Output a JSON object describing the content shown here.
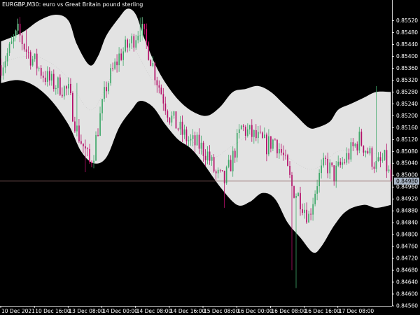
{
  "header": {
    "symbol_title": "EURGBP,M30",
    "description": "euro vs Great Britain pound sterling"
  },
  "colors": {
    "background": "#000000",
    "band_fill": "#e3e3e3",
    "bull_candle": "#7ee0a4",
    "bear_candle": "#e0197d",
    "bull_candle_on_band": "#3fa86a",
    "bear_candle_on_band": "#b5106a",
    "axis_text": "#ffffff",
    "bid_line": "#8a6060",
    "bid_tag_bg": "#a8b4c4"
  },
  "current_price": "0.84980",
  "chart_data": {
    "type": "candlestick",
    "title": "",
    "y_range": [
      0.8456,
      0.8558
    ],
    "y_ticks": [
      "0.85520",
      "0.85480",
      "0.85440",
      "0.85400",
      "0.85360",
      "0.85320",
      "0.85280",
      "0.85240",
      "0.85200",
      "0.85160",
      "0.85120",
      "0.85080",
      "0.85040",
      "0.85000",
      "0.84960",
      "0.84920",
      "0.84880",
      "0.84840",
      "0.84800",
      "0.84760",
      "0.84720",
      "0.84680",
      "0.84640",
      "0.84600",
      "0.84560"
    ],
    "y_tick_values": [
      0.8552,
      0.8548,
      0.8544,
      0.854,
      0.8536,
      0.8532,
      0.8528,
      0.8524,
      0.852,
      0.8516,
      0.8512,
      0.8508,
      0.8504,
      0.85,
      0.8496,
      0.8492,
      0.8488,
      0.8484,
      0.848,
      0.8476,
      0.8472,
      0.8468,
      0.8464,
      0.846,
      0.8456
    ],
    "x_ticks": [
      "10 Dec 2021",
      "10 Dec 16:00",
      "13 Dec 08:00",
      "14 Dec 00:00",
      "14 Dec 08:00",
      "14 Dec 16:00",
      "15 Dec 08:00",
      "16 Dec 00:00",
      "16 Dec 08:00",
      "16 Dec 16:00",
      "17 Dec 08:00"
    ],
    "x_tick_bar_index": [
      0,
      16,
      32,
      48,
      64,
      80,
      96,
      112,
      128,
      144,
      160
    ],
    "bar_count": 186,
    "bollinger": {
      "upper": [
        [
          0,
          0.8545
        ],
        [
          10,
          0.8548
        ],
        [
          18,
          0.8552
        ],
        [
          26,
          0.8554
        ],
        [
          32,
          0.8552
        ],
        [
          36,
          0.8544
        ],
        [
          42,
          0.8537
        ],
        [
          46,
          0.854
        ],
        [
          50,
          0.8547
        ],
        [
          56,
          0.8553
        ],
        [
          60,
          0.8556
        ],
        [
          64,
          0.8554
        ],
        [
          68,
          0.8546
        ],
        [
          74,
          0.8536
        ],
        [
          80,
          0.8529
        ],
        [
          86,
          0.8524
        ],
        [
          92,
          0.8521
        ],
        [
          98,
          0.852
        ],
        [
          104,
          0.8523
        ],
        [
          110,
          0.8528
        ],
        [
          116,
          0.8529
        ],
        [
          122,
          0.853
        ],
        [
          128,
          0.8528
        ],
        [
          134,
          0.8524
        ],
        [
          140,
          0.852
        ],
        [
          146,
          0.8516
        ],
        [
          150,
          0.8516
        ],
        [
          156,
          0.8518
        ],
        [
          160,
          0.8522
        ],
        [
          166,
          0.8524
        ],
        [
          172,
          0.8526
        ],
        [
          178,
          0.8528
        ],
        [
          185,
          0.8528
        ]
      ],
      "middle": [
        [
          0,
          0.8538
        ],
        [
          16,
          0.854
        ],
        [
          30,
          0.8534
        ],
        [
          42,
          0.8522
        ],
        [
          50,
          0.853
        ],
        [
          60,
          0.8544
        ],
        [
          70,
          0.8534
        ],
        [
          80,
          0.8522
        ],
        [
          90,
          0.8512
        ],
        [
          100,
          0.8506
        ],
        [
          110,
          0.851
        ],
        [
          122,
          0.8514
        ],
        [
          136,
          0.8506
        ],
        [
          148,
          0.8502
        ],
        [
          160,
          0.8508
        ],
        [
          172,
          0.8508
        ],
        [
          185,
          0.8506
        ]
      ],
      "lower": [
        [
          0,
          0.8531
        ],
        [
          8,
          0.8532
        ],
        [
          16,
          0.853
        ],
        [
          24,
          0.8525
        ],
        [
          32,
          0.8517
        ],
        [
          38,
          0.8508
        ],
        [
          44,
          0.8504
        ],
        [
          50,
          0.8506
        ],
        [
          56,
          0.8516
        ],
        [
          62,
          0.8522
        ],
        [
          66,
          0.8525
        ],
        [
          72,
          0.8523
        ],
        [
          78,
          0.8517
        ],
        [
          84,
          0.8512
        ],
        [
          90,
          0.8509
        ],
        [
          96,
          0.8504
        ],
        [
          104,
          0.8496
        ],
        [
          112,
          0.849
        ],
        [
          118,
          0.8491
        ],
        [
          124,
          0.8494
        ],
        [
          130,
          0.8492
        ],
        [
          136,
          0.8484
        ],
        [
          142,
          0.8479
        ],
        [
          148,
          0.8474
        ],
        [
          152,
          0.8476
        ],
        [
          158,
          0.8483
        ],
        [
          164,
          0.8488
        ],
        [
          172,
          0.849
        ],
        [
          178,
          0.8489
        ],
        [
          185,
          0.849
        ]
      ]
    },
    "candles": {
      "anchors": [
        [
          0,
          0.8537
        ],
        [
          4,
          0.8542
        ],
        [
          8,
          0.8548
        ],
        [
          12,
          0.8542
        ],
        [
          16,
          0.8538
        ],
        [
          20,
          0.8534
        ],
        [
          24,
          0.8531
        ],
        [
          28,
          0.853
        ],
        [
          32,
          0.8528
        ],
        [
          36,
          0.8515
        ],
        [
          40,
          0.8508
        ],
        [
          42,
          0.8504
        ],
        [
          44,
          0.8508
        ],
        [
          46,
          0.8516
        ],
        [
          50,
          0.853
        ],
        [
          56,
          0.854
        ],
        [
          62,
          0.8545
        ],
        [
          66,
          0.855
        ],
        [
          70,
          0.8542
        ],
        [
          74,
          0.8532
        ],
        [
          80,
          0.852
        ],
        [
          86,
          0.8514
        ],
        [
          90,
          0.8511
        ],
        [
          94,
          0.851
        ],
        [
          98,
          0.8507
        ],
        [
          102,
          0.85
        ],
        [
          106,
          0.8498
        ],
        [
          110,
          0.8506
        ],
        [
          114,
          0.8516
        ],
        [
          118,
          0.8514
        ],
        [
          122,
          0.8512
        ],
        [
          126,
          0.851
        ],
        [
          130,
          0.8512
        ],
        [
          134,
          0.8506
        ],
        [
          138,
          0.8496
        ],
        [
          142,
          0.8492
        ],
        [
          146,
          0.8486
        ],
        [
          150,
          0.8498
        ],
        [
          154,
          0.8504
        ],
        [
          158,
          0.85
        ],
        [
          162,
          0.8504
        ],
        [
          166,
          0.8508
        ],
        [
          170,
          0.8512
        ],
        [
          174,
          0.8508
        ],
        [
          178,
          0.8503
        ],
        [
          182,
          0.8505
        ],
        [
          185,
          0.8498
        ]
      ],
      "spikes": [
        [
          36,
          0.8531,
          null
        ],
        [
          138,
          null,
          0.8468
        ],
        [
          140,
          null,
          0.8462
        ],
        [
          106,
          null,
          0.8489
        ],
        [
          40,
          null,
          0.8501
        ],
        [
          66,
          0.8553,
          null
        ],
        [
          178,
          0.853,
          null
        ],
        [
          48,
          0.8522,
          null
        ],
        [
          12,
          0.8549,
          null
        ]
      ]
    }
  }
}
